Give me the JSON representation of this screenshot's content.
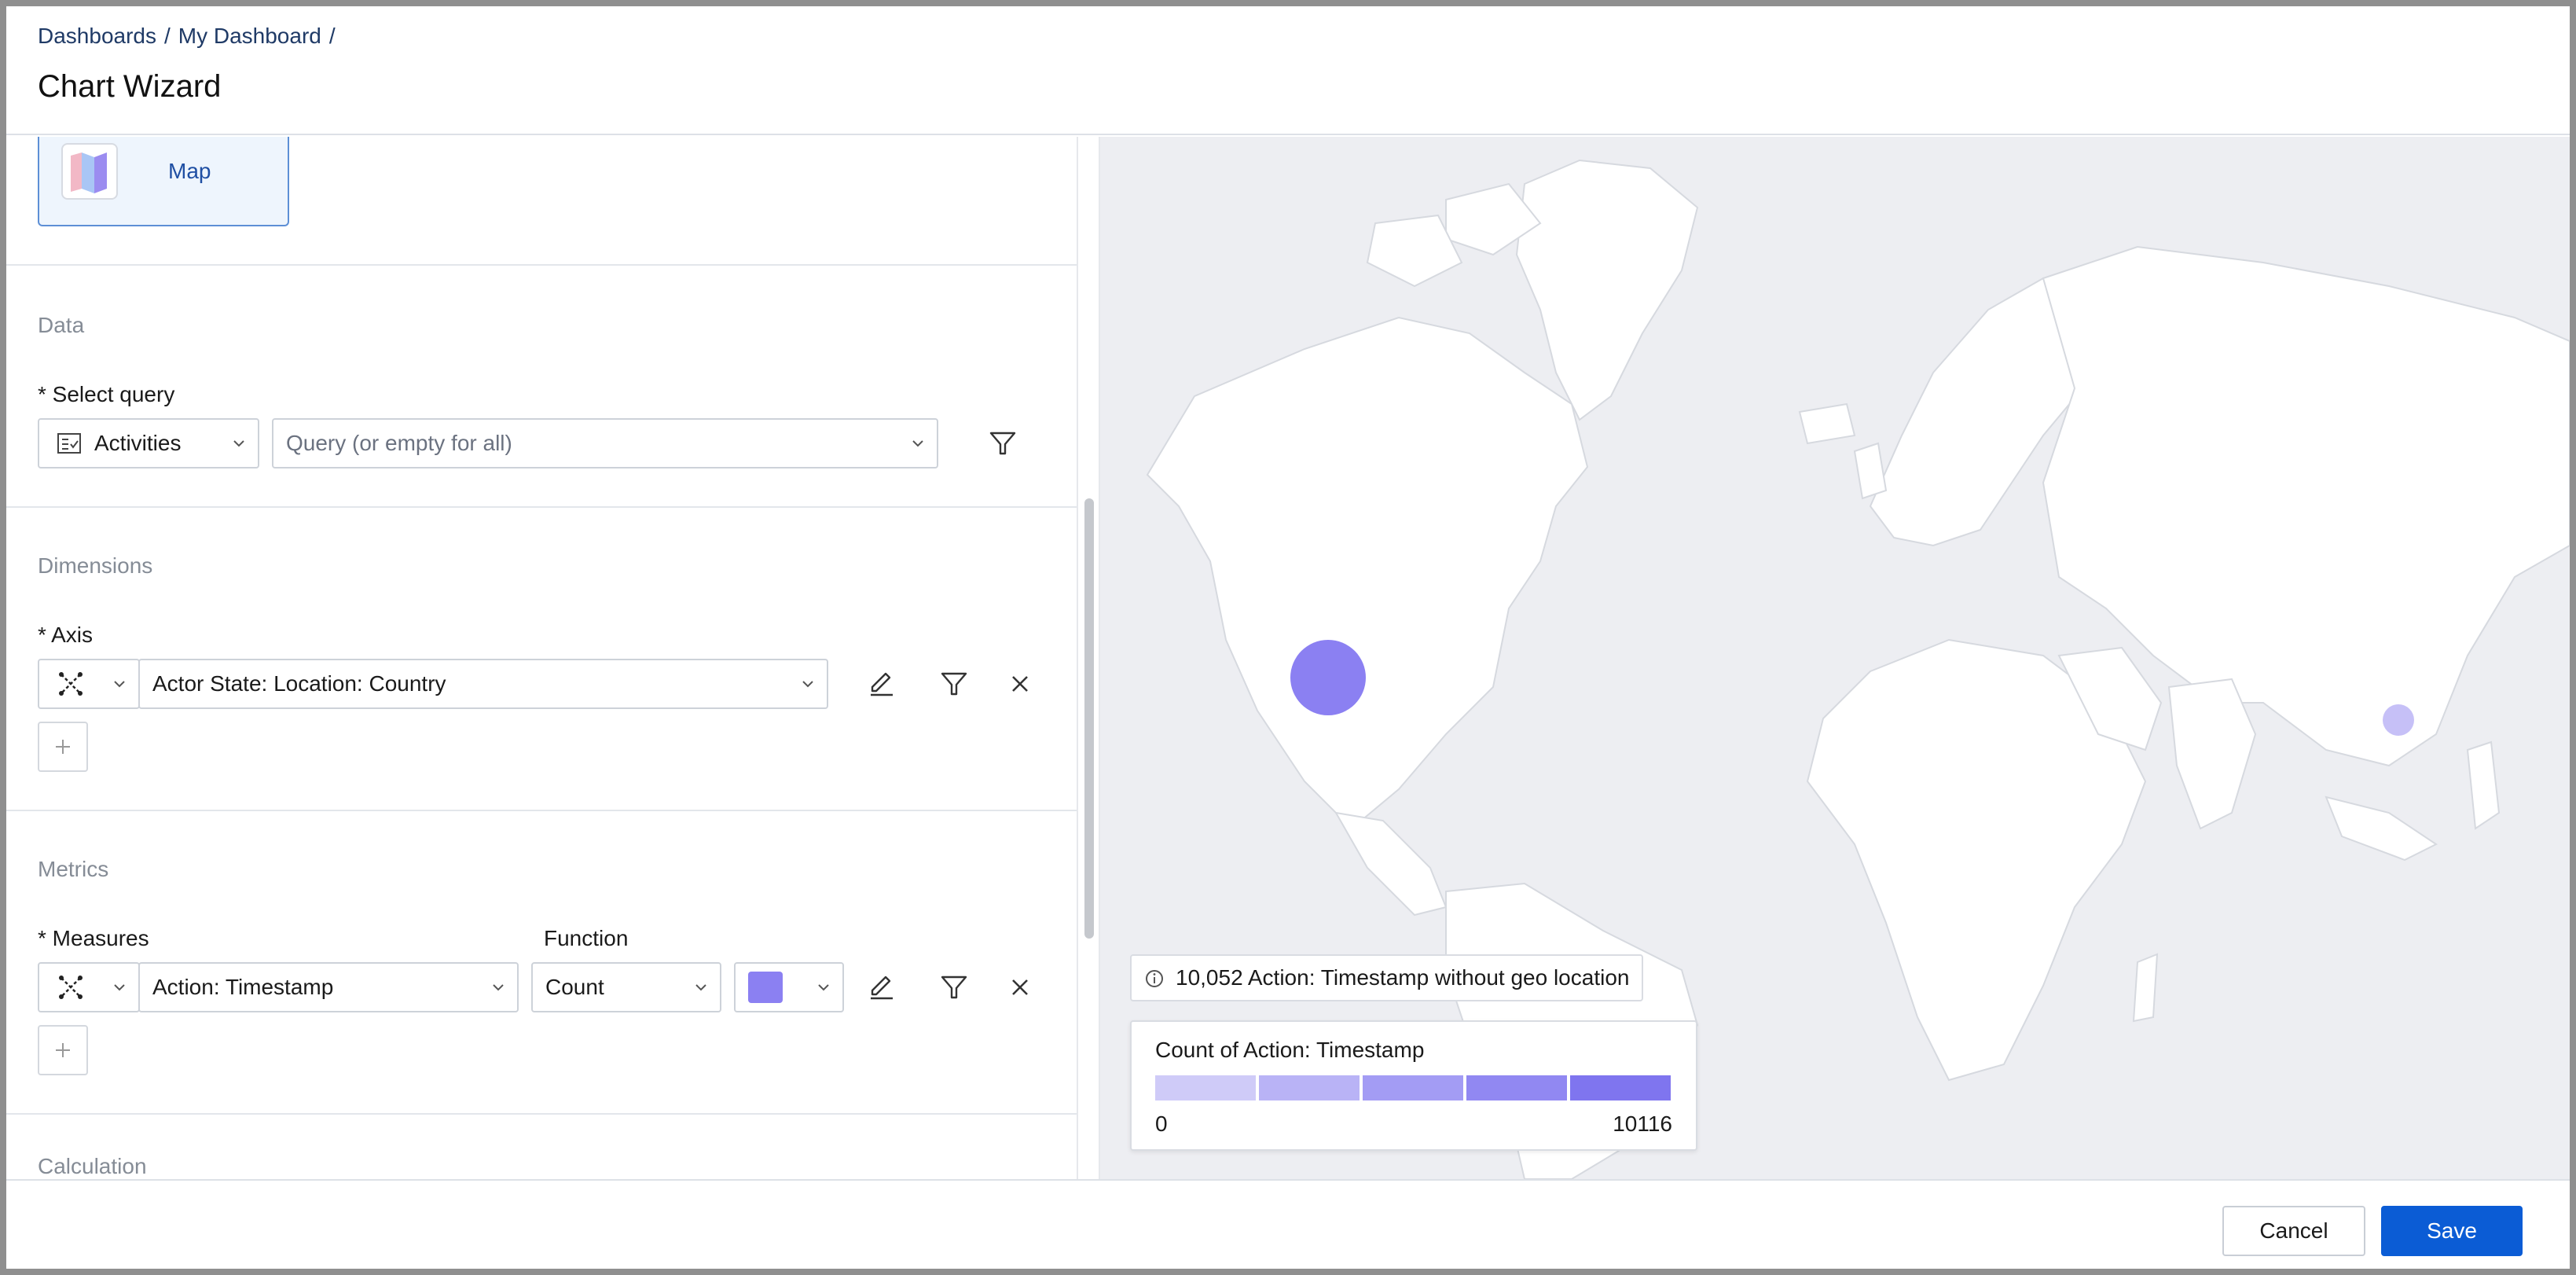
{
  "breadcrumb": {
    "items": [
      "Dashboards",
      "My Dashboard"
    ],
    "separator": "/"
  },
  "page": {
    "title": "Chart Wizard"
  },
  "chart_type": {
    "selected": "Map",
    "icon": "map-icon"
  },
  "data_section": {
    "title": "Data",
    "select_query_label": "* Select query",
    "source": "Activities",
    "query_placeholder": "Query (or empty for all)"
  },
  "dimensions": {
    "title": "Dimensions",
    "axis_label": "* Axis",
    "axis_value": "Actor State: Location: Country"
  },
  "metrics": {
    "title": "Metrics",
    "measures_label": "* Measures",
    "function_label": "Function",
    "measure_value": "Action: Timestamp",
    "function_value": "Count",
    "color": "#8b80f2"
  },
  "calculation": {
    "title": "Calculation"
  },
  "map": {
    "background": "#edeef2",
    "land_color": "#ffffff",
    "geo_note": "10,052 Action: Timestamp without geo location",
    "legend": {
      "title": "Count of Action: Timestamp",
      "min": "0",
      "max": "10116",
      "colors": [
        "#cfcbf8",
        "#b9b3f6",
        "#a39cf4",
        "#9188f2",
        "#7f75ef"
      ]
    },
    "bubbles": [
      {
        "location": "United States",
        "color": "#8b80f2"
      },
      {
        "location": "China",
        "color": "#c6c0f7"
      }
    ]
  },
  "footer": {
    "cancel_label": "Cancel",
    "save_label": "Save"
  }
}
